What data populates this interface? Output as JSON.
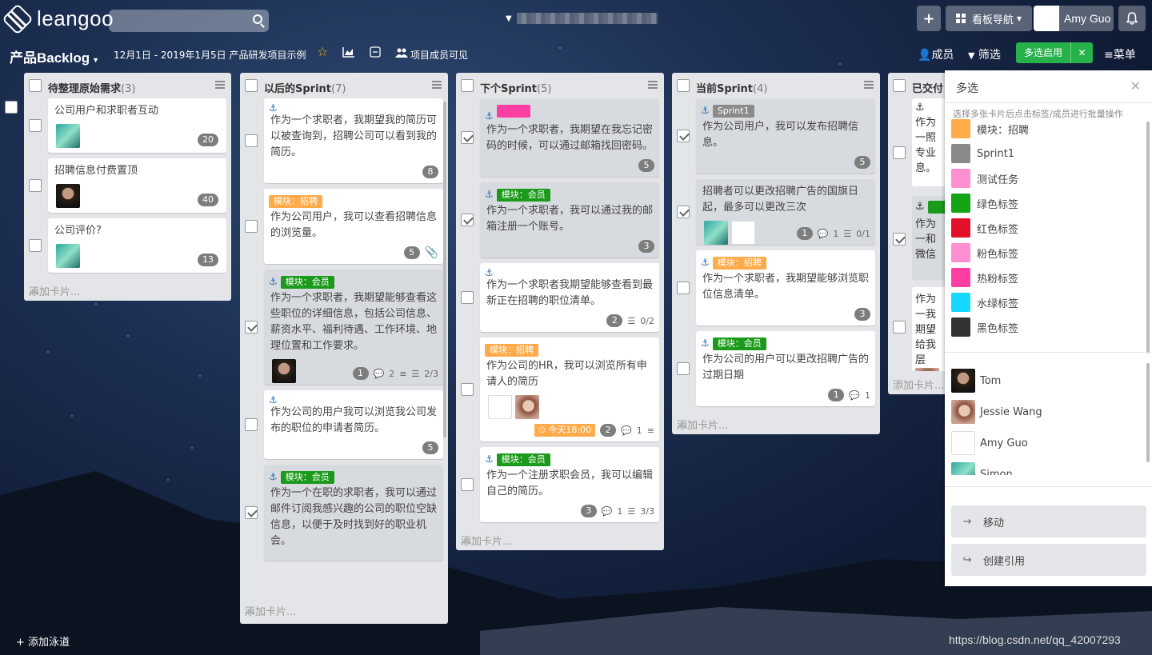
{
  "app": {
    "logo_text": "leangoo",
    "user_name": "Amy Guo",
    "nav_label": "看板导航"
  },
  "board": {
    "title": "产品Backlog",
    "date_range": "12月1日 - 2019年1月5日",
    "project": "产品研发项目示例",
    "visibility": "项目成员可见",
    "members_label": "成员",
    "filter_label": "筛选",
    "multi_on_label": "多选启用",
    "menu_label": "菜单",
    "add_lane": "添加泳道"
  },
  "lists": [
    {
      "name": "待整理原始需求",
      "count": "(3)",
      "add": "添加卡片...",
      "cards": [
        {
          "title": "公司用户和求职者互动",
          "badge": "20"
        },
        {
          "title": "招聘信息付费置顶",
          "badge": "40"
        },
        {
          "title": "公司评价?",
          "badge": "13"
        }
      ]
    },
    {
      "name": "以后的Sprint",
      "count": "(7)",
      "add": "添加卡片...",
      "cards": [
        {
          "title": "作为一个求职者，我期望我的简历可以被查询到，招聘公司可以看到我的简历。",
          "badge": "8"
        },
        {
          "label": "模块：招聘",
          "title": "作为公司用户，我可以查看招聘信息的浏览量。",
          "badge": "5"
        },
        {
          "label": "模块：会员",
          "title": "作为一个求职者，我期望能够查看这些职位的详细信息，包括公司信息、薪资水平、福利待遇、工作环境、地理位置和工作要求。",
          "badge": "1",
          "comments": "2",
          "checklist": "2/3"
        },
        {
          "title": "作为公司的用户我可以浏览我公司发布的职位的申请者简历。",
          "badge": "5"
        },
        {
          "label": "模块：会员",
          "title": "作为一个在职的求职者，我可以通过邮件订阅我感兴趣的公司的职位空缺信息，以便于及时找到好的职业机会。"
        }
      ]
    },
    {
      "name": "下个Sprint",
      "count": "(5)",
      "add": "添加卡片...",
      "cards": [
        {
          "title": "作为一个求职者，我期望在我忘记密码的时候，可以通过邮箱找回密码。",
          "badge": "5"
        },
        {
          "label": "模块：会员",
          "title": "作为一个求职者，我可以通过我的邮箱注册一个账号。",
          "badge": "3"
        },
        {
          "title": "作为一个求职者我期望能够查看到最新正在招聘的职位清单。",
          "badge": "2",
          "checklist": "0/2"
        },
        {
          "label": "模块：招聘",
          "title": "作为公司的HR，我可以浏览所有申请人的简历",
          "due": "今天18:00",
          "badge": "2",
          "comments": "1"
        },
        {
          "label": "模块：会员",
          "title": "作为一个注册求职会员，我可以编辑自己的简历。",
          "badge": "3",
          "comments": "1",
          "checklist": "3/3"
        }
      ]
    },
    {
      "name": "当前Sprint",
      "count": "(4)",
      "add": "添加卡片...",
      "cards": [
        {
          "label": "Sprint1",
          "title": "作为公司用户，我可以发布招聘信息。",
          "badge": "5"
        },
        {
          "title": "招聘者可以更改招聘广告的国旗日起，最多可以更改三次",
          "badge": "1",
          "comments": "1",
          "checklist": "0/1"
        },
        {
          "label": "模块：招聘",
          "title": "作为一个求职者，我期望能够浏览职位信息清单。",
          "badge": "3"
        },
        {
          "label": "模块：会员",
          "title": "作为公司的用户可以更改招聘广告的过期日期",
          "badge": "1",
          "comments": "1"
        }
      ]
    },
    {
      "name": "已交付",
      "add": "添加卡片...",
      "cards": [
        {
          "title": "作为一照专业息。"
        },
        {
          "title": "作为一和微信"
        },
        {
          "title": "作为一我期望给我层"
        }
      ]
    }
  ],
  "panel": {
    "title": "多选",
    "hint": "选择多张卡片后点击标签/成员进行批量操作",
    "tags": [
      {
        "name": "模块：招聘",
        "color": "#ffab4a"
      },
      {
        "name": "Sprint1",
        "color": "#8a8a8a"
      },
      {
        "name": "测试任务",
        "color": "#ff8fd0"
      },
      {
        "name": "绿色标签",
        "color": "#14a314"
      },
      {
        "name": "红色标签",
        "color": "#e3102a"
      },
      {
        "name": "粉色标签",
        "color": "#ff8fd0"
      },
      {
        "name": "热粉标签",
        "color": "#ff3ea4"
      },
      {
        "name": "水绿标签",
        "color": "#16d9ff"
      },
      {
        "name": "黑色标签",
        "color": "#333333"
      }
    ],
    "members": [
      "Tom",
      "Jessie Wang",
      "Amy Guo",
      "Simon"
    ],
    "move_label": "移动",
    "ref_label": "创建引用"
  },
  "watermark": "https://blog.csdn.net/qq_42007293"
}
